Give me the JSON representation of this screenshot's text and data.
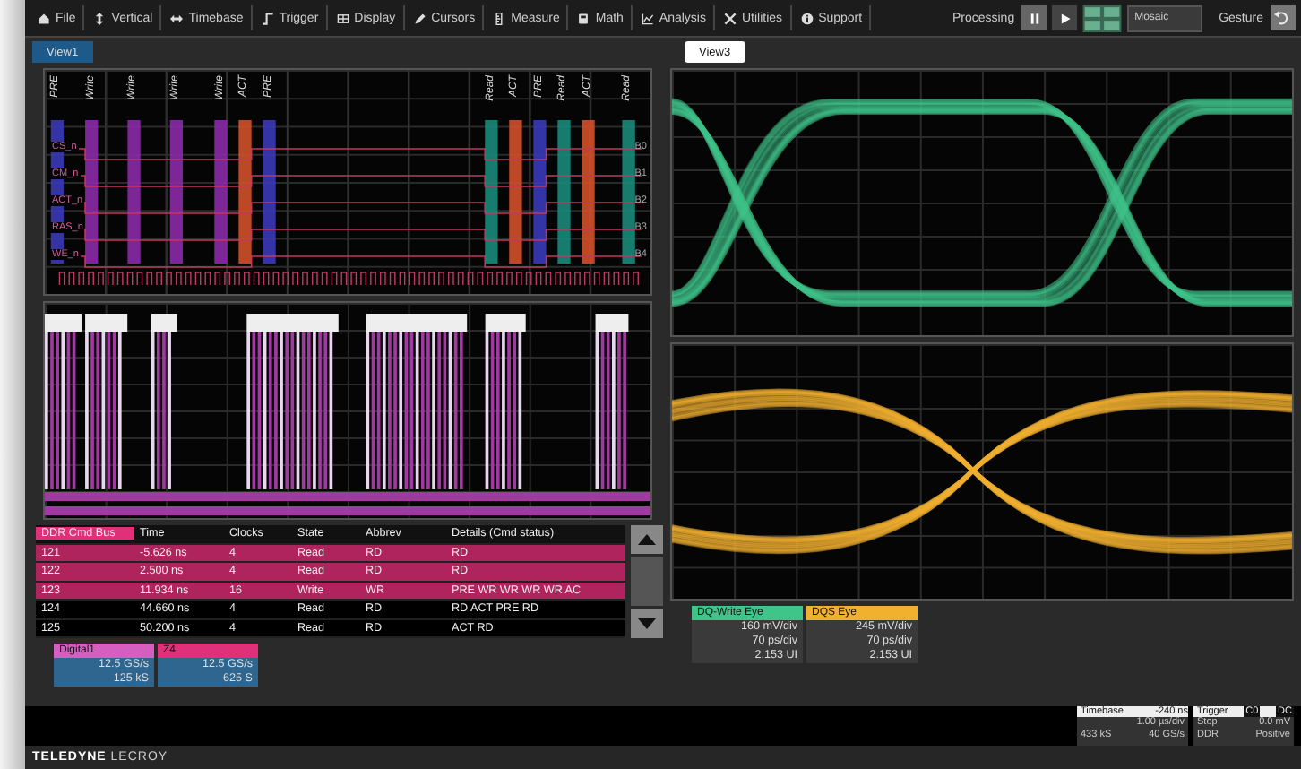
{
  "menu": [
    {
      "label": "File",
      "kind": "file"
    },
    {
      "label": "Vertical",
      "kind": "vertical"
    },
    {
      "label": "Timebase",
      "kind": "timebase"
    },
    {
      "label": "Trigger",
      "kind": "trigger"
    },
    {
      "label": "Display",
      "kind": "display"
    },
    {
      "label": "Cursors",
      "kind": "cursors"
    },
    {
      "label": "Measure",
      "kind": "measure"
    },
    {
      "label": "Math",
      "kind": "math"
    },
    {
      "label": "Analysis",
      "kind": "analysis"
    },
    {
      "label": "Utilities",
      "kind": "utilities"
    },
    {
      "label": "Support",
      "kind": "support"
    }
  ],
  "processing": {
    "label": "Processing",
    "paused": true,
    "layout": "Mosaic",
    "gesture": "Gesture"
  },
  "tabs": [
    {
      "label": "View1",
      "selected": false
    },
    {
      "label": "View3",
      "selected": true
    }
  ],
  "timing": {
    "commands": [
      {
        "label": "PRE",
        "kind": "pre"
      },
      {
        "label": "Write",
        "kind": "write"
      },
      {
        "label": "Write",
        "kind": "write"
      },
      {
        "label": "Write",
        "kind": "write"
      },
      {
        "label": "Write",
        "kind": "write"
      },
      {
        "label": "ACT",
        "kind": "act"
      },
      {
        "label": "PRE",
        "kind": "pre"
      },
      {
        "label": "Read",
        "kind": "read"
      },
      {
        "label": "ACT",
        "kind": "act"
      },
      {
        "label": "PRE",
        "kind": "pre"
      },
      {
        "label": "Read",
        "kind": "read"
      },
      {
        "label": "ACT",
        "kind": "act"
      },
      {
        "label": "Read",
        "kind": "read"
      }
    ],
    "signals": [
      {
        "name": "CS_n",
        "tag": "B0"
      },
      {
        "name": "CM_n",
        "tag": "B1"
      },
      {
        "name": "ACT_n",
        "tag": "B2"
      },
      {
        "name": "RAS_n",
        "tag": "B3"
      },
      {
        "name": "WE_n",
        "tag": "B4"
      }
    ]
  },
  "table": {
    "columns": [
      "DDR Cmd Bus",
      "Time",
      "Clocks",
      "State",
      "Abbrev",
      "Details (Cmd status)"
    ],
    "rows": [
      {
        "cells": [
          "121",
          "-5.626 ns",
          "4",
          "Read",
          "RD",
          "RD"
        ],
        "highlighted": true
      },
      {
        "cells": [
          "122",
          "2.500 ns",
          "4",
          "Read",
          "RD",
          "RD"
        ],
        "highlighted": true
      },
      {
        "cells": [
          "123",
          "11.934 ns",
          "16",
          "Write",
          "WR",
          "PRE WR WR WR WR AC"
        ],
        "highlighted": true
      },
      {
        "cells": [
          "124",
          "44.660 ns",
          "4",
          "Read",
          "RD",
          "RD ACT PRE RD"
        ],
        "highlighted": false
      },
      {
        "cells": [
          "125",
          "50.200 ns",
          "4",
          "Read",
          "RD",
          "ACT RD"
        ],
        "highlighted": false
      }
    ]
  },
  "channels": [
    {
      "title": "Digital1",
      "color": "#d45fc0",
      "lines": [
        "12.5 GS/s",
        "125 kS"
      ]
    },
    {
      "title": "Z4",
      "color": "#e0307a",
      "lines": [
        "12.5 GS/s",
        "625 S"
      ]
    }
  ],
  "eyes": [
    {
      "title": "DQ-Write Eye",
      "color": "#3fc48a",
      "lines": [
        "160 mV/div",
        "70 ps/div",
        "2.153 UI"
      ]
    },
    {
      "title": "DQS Eye",
      "color": "#f0b030",
      "lines": [
        "245 mV/div",
        "70 ps/div",
        "2.153 UI"
      ]
    }
  ],
  "timebase": {
    "title": "Timebase",
    "delay": "-240 ns",
    "scale": "1.00 µs/div",
    "samples": "433 kS",
    "rate": "40 GS/s"
  },
  "trigger": {
    "title": "Trigger",
    "badges": [
      "C0",
      "DC"
    ],
    "mode": "Stop",
    "level": "0.0 mV",
    "type": "DDR",
    "slope": "Positive"
  },
  "brand": {
    "primary": "TELEDYNE",
    "secondary": "LECROY"
  }
}
